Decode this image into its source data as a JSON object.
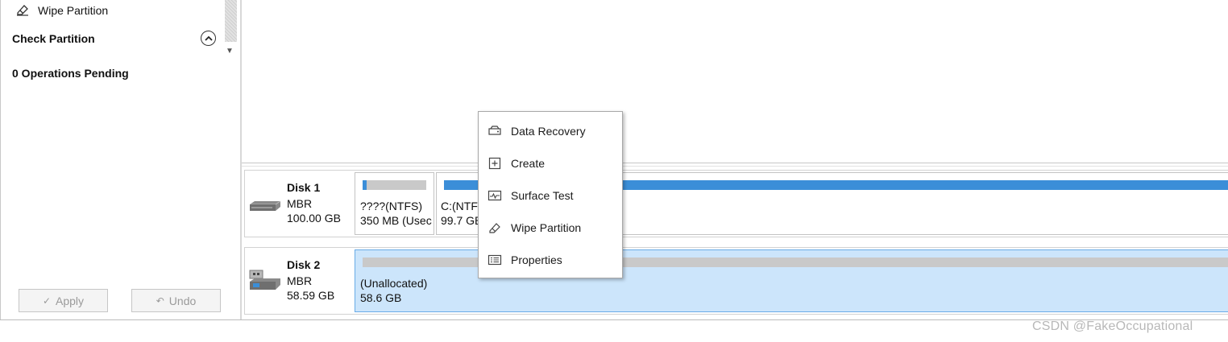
{
  "sidebar": {
    "wipe_partition": "Wipe Partition",
    "check_partition": "Check Partition",
    "operations_pending": "0 Operations Pending",
    "apply_label": "Apply",
    "undo_label": "Undo"
  },
  "disks": [
    {
      "name": "Disk 1",
      "type": "MBR",
      "size": "100.00 GB",
      "partitions": [
        {
          "line1": "????(NTFS)",
          "line2": "350 MB (Usec"
        },
        {
          "line1": "C:(NTF",
          "line2": "99.7 GB"
        }
      ]
    },
    {
      "name": "Disk 2",
      "type": "MBR",
      "size": "58.59 GB",
      "partitions": [
        {
          "line1": "(Unallocated)",
          "line2": "58.6 GB"
        }
      ]
    }
  ],
  "context_menu": {
    "items": [
      {
        "label": "Data Recovery",
        "icon": "drive-icon"
      },
      {
        "label": "Create",
        "icon": "plus-box-icon"
      },
      {
        "label": "Surface Test",
        "icon": "pulse-icon"
      },
      {
        "label": "Wipe Partition",
        "icon": "eraser-icon"
      },
      {
        "label": "Properties",
        "icon": "list-icon"
      }
    ]
  },
  "colors": {
    "accent": "#3b8ed8",
    "selected_bg": "#cce5fb",
    "bar_gray": "#c9c9c9"
  },
  "watermark": "CSDN @FakeOccupational"
}
